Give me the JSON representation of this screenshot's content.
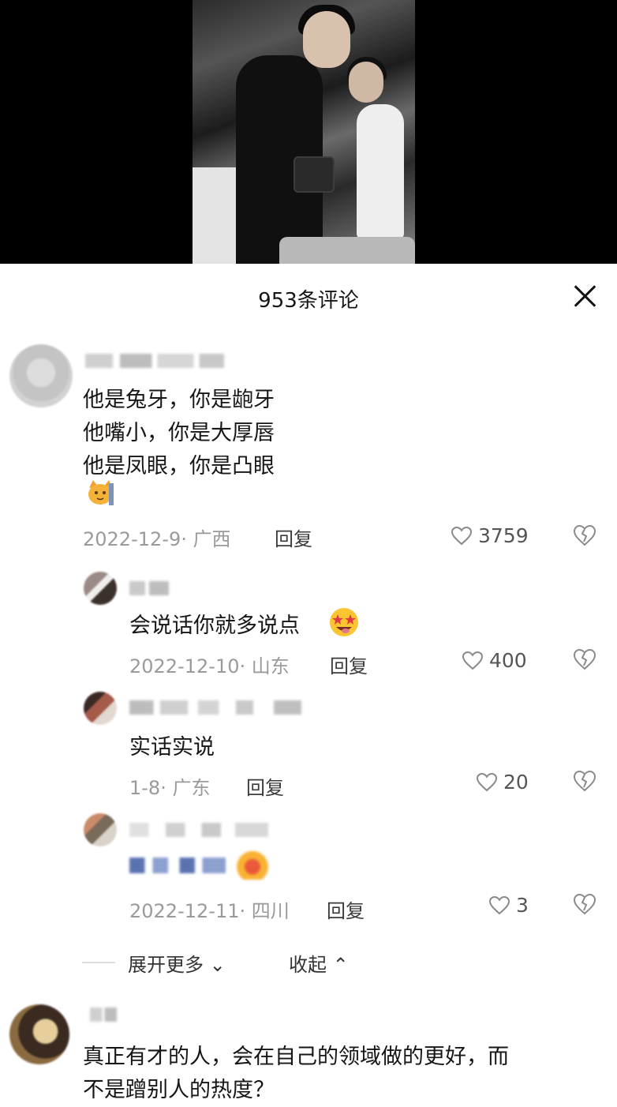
{
  "comments_header": {
    "title": "953条评论"
  },
  "comments": [
    {
      "lines": [
        "他是兔牙，你是龅牙",
        "他嘴小，你是大厚唇",
        "他是凤眼，你是凸眼"
      ],
      "emoji": "cat-emoji",
      "date_location": "2022-12-9· 广西",
      "reply_label": "回复",
      "likes": "3759"
    },
    {
      "lines": [
        "会说话你就多说点"
      ],
      "emoji": "star-struck-emoji",
      "date_location": "2022-12-10· 山东",
      "reply_label": "回复",
      "likes": "400"
    },
    {
      "lines": [
        "实话实说"
      ],
      "date_location": "1-8· 广东",
      "reply_label": "回复",
      "likes": "20"
    },
    {
      "lines": [],
      "emoji": "pixel-emoji",
      "date_location": "2022-12-11· 四川",
      "reply_label": "回复",
      "likes": "3"
    },
    {
      "lines": [
        "真正有才的人，会在自己的领域做的更好，而",
        "不是蹭别人的热度？"
      ]
    }
  ],
  "controls": {
    "expand_more": "展开更多",
    "collapse": "收起"
  },
  "icons": {
    "close": "close-icon",
    "like": "heart-icon",
    "dislike": "broken-heart-icon"
  },
  "colors": {
    "text": "#161616",
    "meta": "#9a9a9a",
    "background": "#ffffff"
  }
}
